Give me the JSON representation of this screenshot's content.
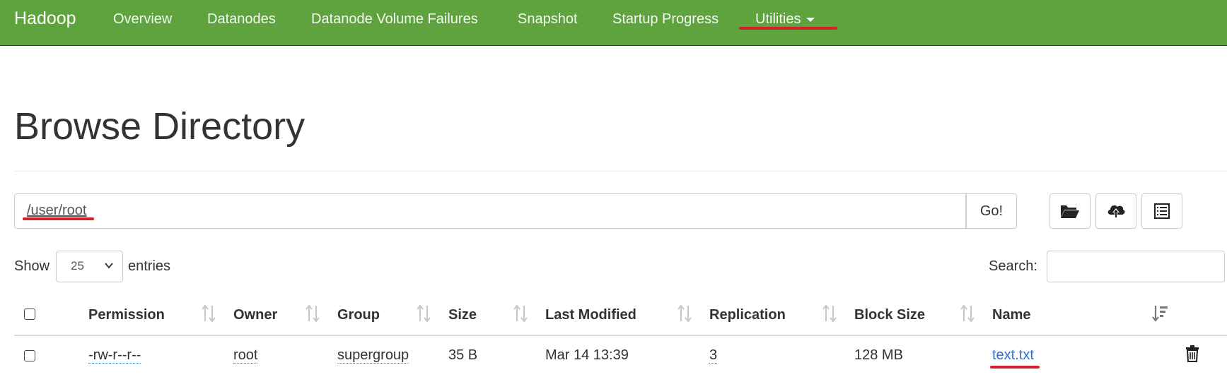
{
  "navbar": {
    "brand": "Hadoop",
    "items": [
      "Overview",
      "Datanodes",
      "Datanode Volume Failures",
      "Snapshot",
      "Startup Progress",
      "Utilities"
    ],
    "bg_color": "#5fa33e"
  },
  "page": {
    "title": "Browse Directory"
  },
  "path_bar": {
    "value": "/user/root",
    "go_label": "Go!",
    "tools": [
      "folder-open-icon",
      "cloud-upload-icon",
      "list-alt-icon"
    ]
  },
  "entries": {
    "show_label": "Show",
    "selected": "25",
    "entries_label": "entries",
    "search_label": "Search:"
  },
  "table": {
    "columns": [
      "Permission",
      "Owner",
      "Group",
      "Size",
      "Last Modified",
      "Replication",
      "Block Size",
      "Name"
    ],
    "rows": [
      {
        "permission": "-rw-r--r--",
        "owner": "root",
        "group": "supergroup",
        "size": "35 B",
        "last_modified": "Mar 14 13:39",
        "replication": "3",
        "block_size": "128 MB",
        "name": "text.txt"
      }
    ]
  },
  "annotations": {
    "highlight_color": "#d3202a"
  }
}
